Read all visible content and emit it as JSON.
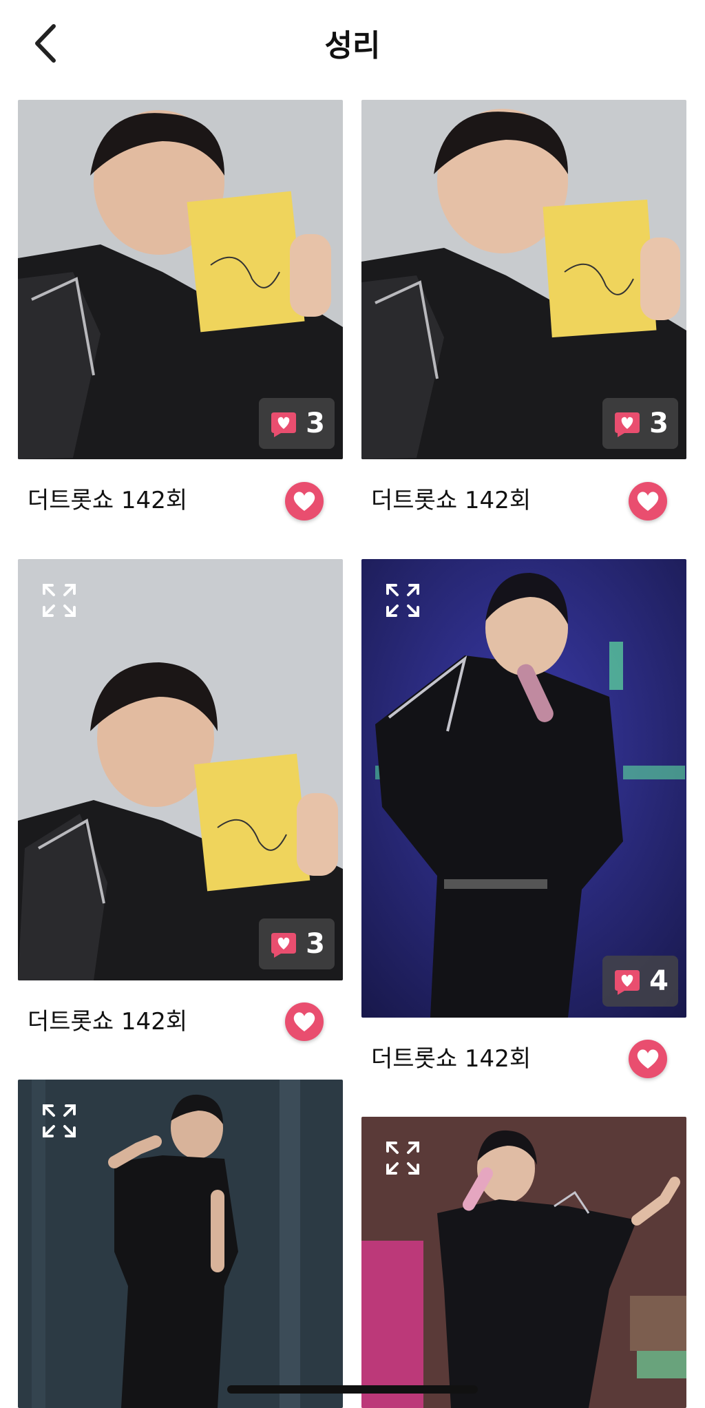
{
  "header": {
    "title": "성리"
  },
  "cards": [
    {
      "caption": "더트롯쇼 142회",
      "count": "3"
    },
    {
      "caption": "더트롯쇼 142회",
      "count": "3"
    },
    {
      "caption": "더트롯쇼 142회",
      "count": "3"
    },
    {
      "caption": "더트롯쇼 142회",
      "count": "4"
    }
  ],
  "icons": {
    "back": "chevron-left-icon",
    "expand": "expand-icon",
    "like": "heart-icon",
    "comment": "heart-bubble-icon"
  },
  "colors": {
    "accent": "#e94e6f",
    "badge_bg": "#464646"
  }
}
